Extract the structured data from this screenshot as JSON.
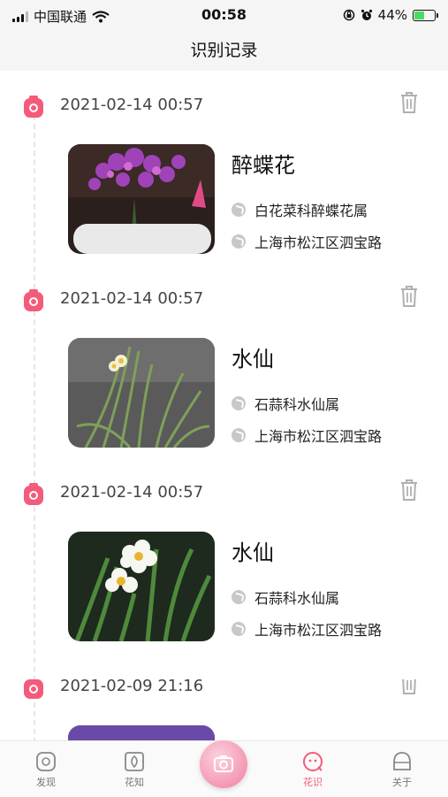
{
  "status_bar": {
    "carrier": "中国联通",
    "time": "00:58",
    "battery": "44%"
  },
  "header": {
    "title": "识别记录"
  },
  "records": [
    {
      "date": "2021-02-14 00:57",
      "name": "醉蝶花",
      "family": "白花菜科醉蝶花属",
      "location": "上海市松江区泗宝路"
    },
    {
      "date": "2021-02-14 00:57",
      "name": "水仙",
      "family": "石蒜科水仙属",
      "location": "上海市松江区泗宝路"
    },
    {
      "date": "2021-02-14 00:57",
      "name": "水仙",
      "family": "石蒜科水仙属",
      "location": "上海市松江区泗宝路"
    },
    {
      "date": "2021-02-09 21:16",
      "name": "",
      "family": "",
      "location": ""
    }
  ],
  "tab_bar": {
    "tabs": [
      {
        "label": "发现",
        "icon": "discover-icon"
      },
      {
        "label": "花知",
        "icon": "flower-knowledge-icon"
      },
      {
        "label": "",
        "icon": "camera-icon"
      },
      {
        "label": "花识",
        "icon": "flower-identify-icon"
      },
      {
        "label": "关于",
        "icon": "about-icon"
      }
    ],
    "active_color": "#f45b7a"
  },
  "colors": {
    "accent": "#f45b7a",
    "battery_fill": "#4cd964"
  }
}
